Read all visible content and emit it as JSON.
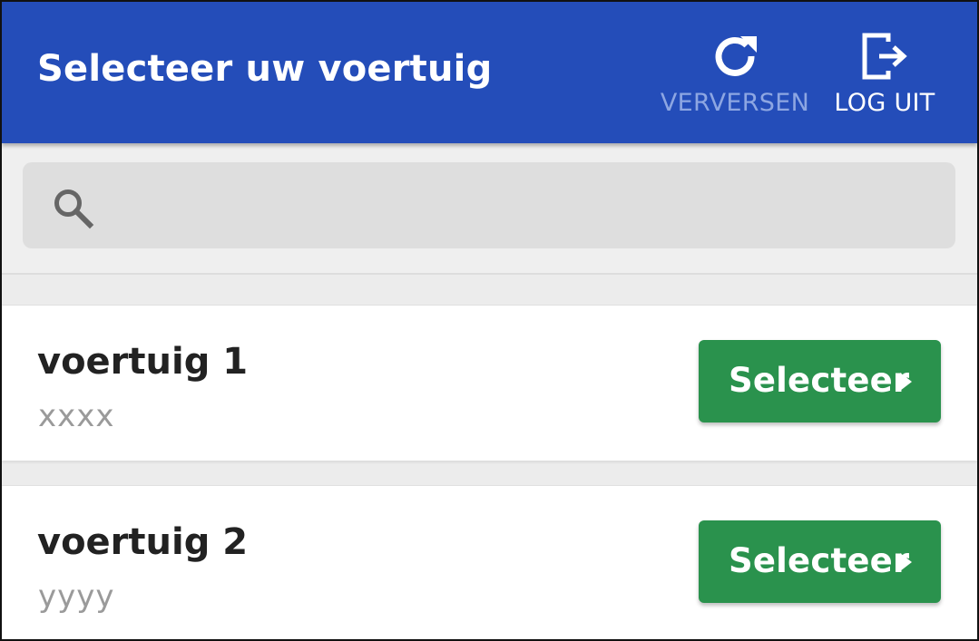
{
  "header": {
    "title": "Selecteer uw voertuig",
    "actions": [
      {
        "label": "VERVERSEN",
        "icon": "refresh-icon",
        "enabled": false
      },
      {
        "label": "LOG UIT",
        "icon": "logout-icon",
        "enabled": true
      }
    ]
  },
  "search": {
    "value": "",
    "placeholder": "",
    "icon": "search-icon"
  },
  "vehicles": [
    {
      "name": "voertuig 1",
      "plate": "xxxx",
      "button_label": "Selecteer",
      "button_icon": "chevron-right-icon"
    },
    {
      "name": "voertuig 2",
      "plate": "yyyy",
      "button_label": "Selecteer",
      "button_icon": "chevron-right-icon"
    }
  ],
  "colors": {
    "header_bg": "#244db9",
    "disabled_action": "#8da6e2",
    "button_bg": "#2a924d",
    "page_bg": "#ececec"
  }
}
